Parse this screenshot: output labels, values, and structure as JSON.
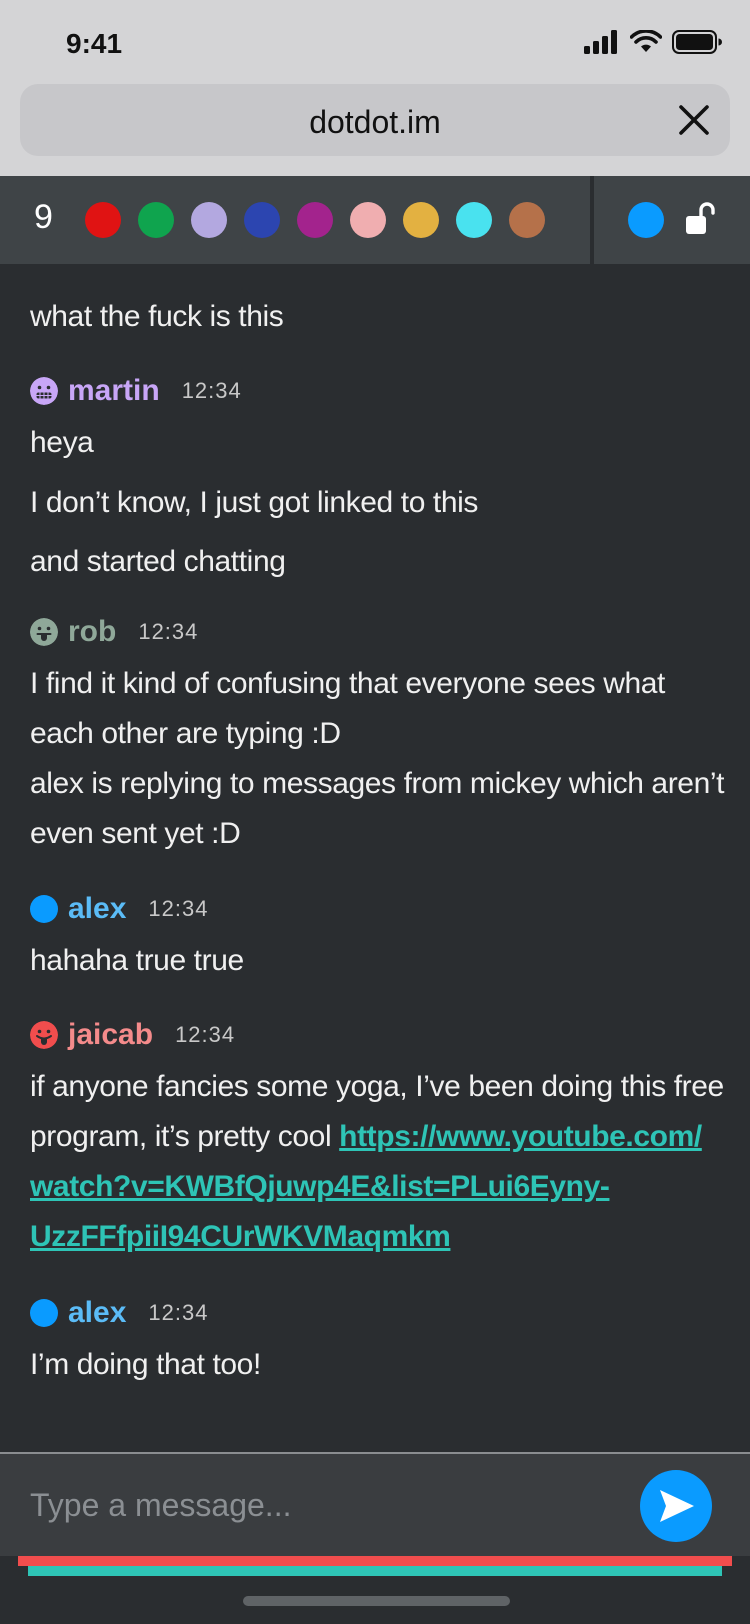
{
  "status_bar": {
    "time": "9:41"
  },
  "browser": {
    "url": "dotdot.im"
  },
  "toolbar": {
    "user_count": "9",
    "user_dots": [
      "#e01313",
      "#0fa44e",
      "#b3a8e0",
      "#2c45b0",
      "#a3238d",
      "#f0aeb0",
      "#e3b141",
      "#49e2ef",
      "#b5714a"
    ],
    "self_color": "#0a9bff"
  },
  "chat": {
    "line_0": "what the fuck is this",
    "msg_1": {
      "name": "martin",
      "time": "12:34",
      "color": "#c8a6f7",
      "lines": [
        "heya",
        "I don’t know, I just got linked to this",
        "and started chatting"
      ]
    },
    "msg_2": {
      "name": "rob",
      "time": "12:34",
      "color": "#8fa899",
      "lines": [
        "I find it kind of confusing that everyone sees what",
        "each other are typing :D",
        "alex is replying to messages from mickey which aren’t",
        "even sent yet :D"
      ]
    },
    "msg_3": {
      "name": "alex",
      "time": "12:34",
      "color": "#5bbcf7",
      "lines": [
        "hahaha true true"
      ]
    },
    "msg_4": {
      "name": "jaicab",
      "time": "12:34",
      "color": "#f48b8b",
      "text_before_link": "if anyone fancies some yoga, I’ve been doing this free",
      "text_program": "program, it’s pretty cool ",
      "link_part_1": "https://www.youtube.com/",
      "link_part_2": "watch?v=KWBfQjuwp4E&list=PLui6Eyny-",
      "link_part_3": "UzzFFfpiiI94CUrWKVMaqmkm"
    },
    "msg_5": {
      "name": "alex",
      "time": "12:34",
      "color": "#5bbcf7",
      "lines": [
        "I’m doing that too!"
      ]
    }
  },
  "composer": {
    "placeholder": "Type a message..."
  },
  "accent": {
    "red": "#f14d4d",
    "teal": "#2ec4b6",
    "blue": "#0a9bff"
  }
}
